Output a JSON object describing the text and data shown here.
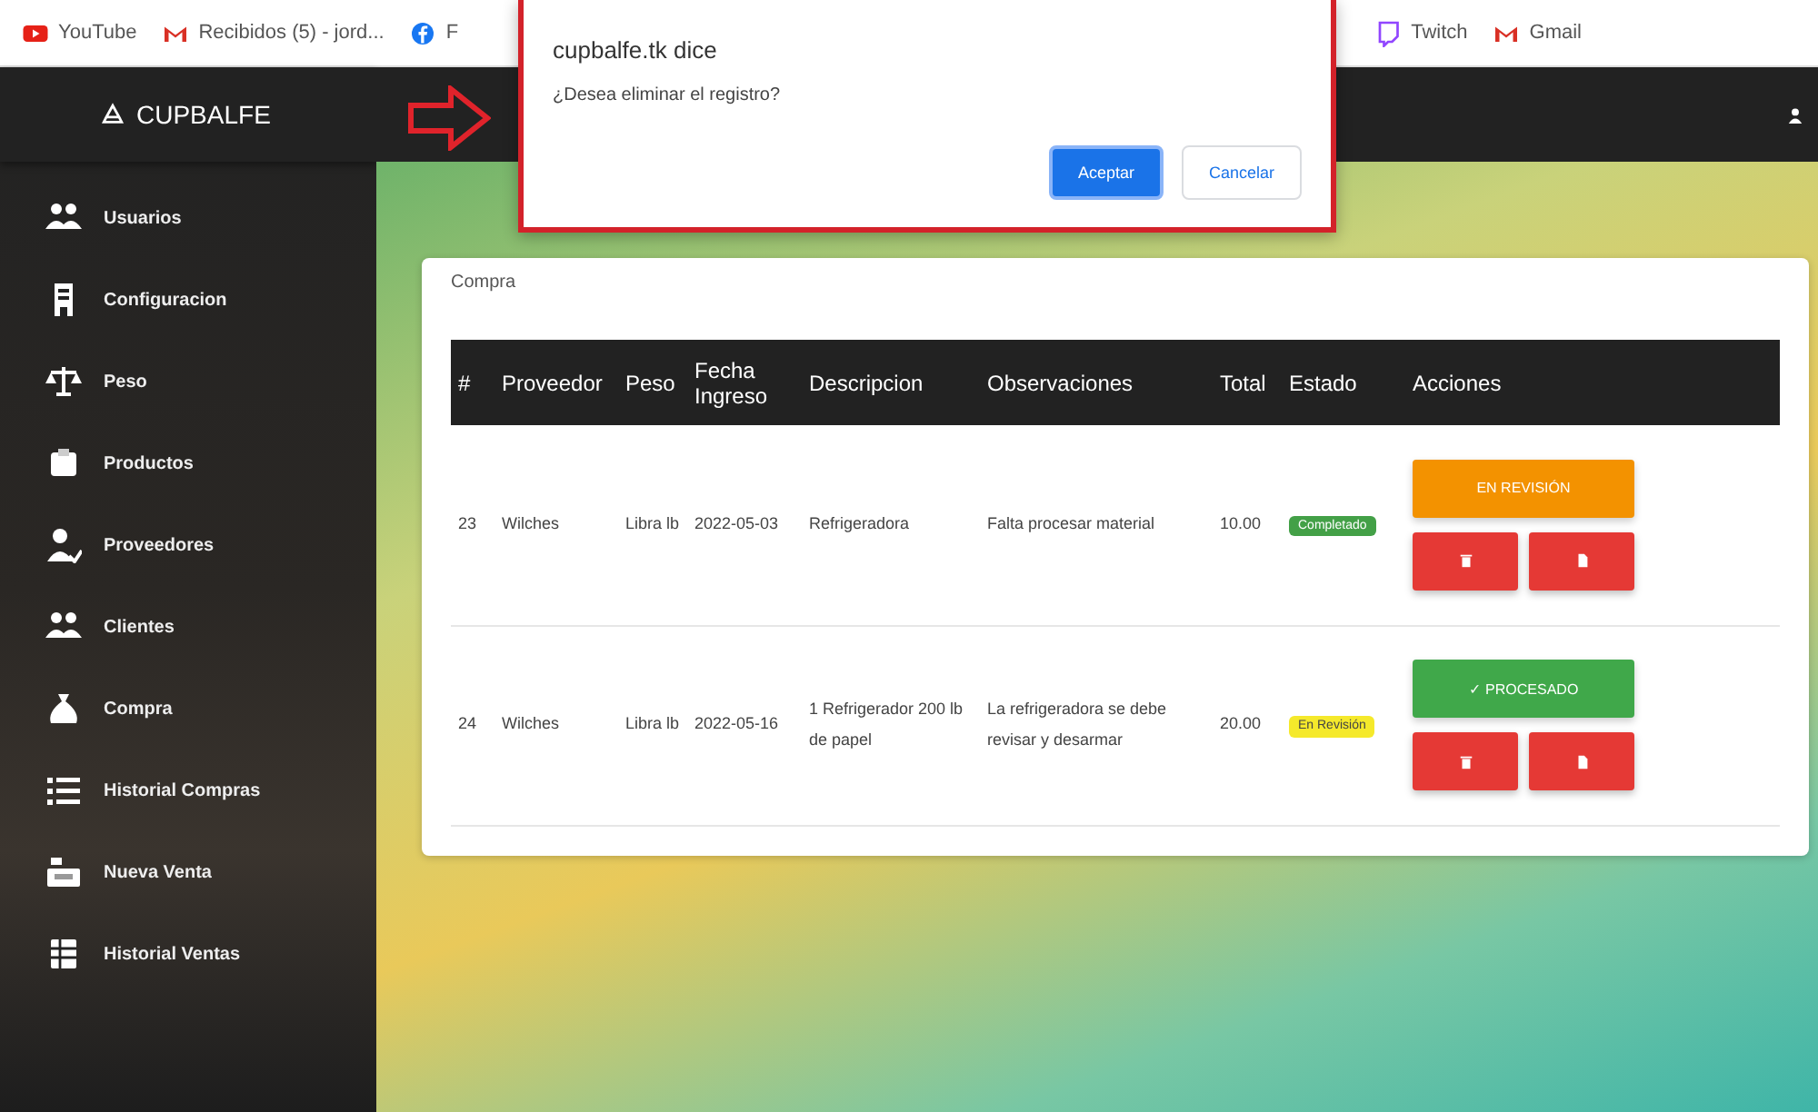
{
  "bookmarks": [
    {
      "kind": "youtube",
      "label": "YouTube"
    },
    {
      "kind": "gmail",
      "label": "Recibidos (5) - jord..."
    },
    {
      "kind": "facebook",
      "label": "F"
    },
    {
      "kind": "twitch",
      "label": "Twitch"
    },
    {
      "kind": "gmail",
      "label": "Gmail"
    }
  ],
  "brand": "CUPBALFE",
  "sidebar": {
    "items": [
      {
        "kind": "users",
        "label": "Usuarios"
      },
      {
        "kind": "building",
        "label": "Configuracion"
      },
      {
        "kind": "scale",
        "label": "Peso"
      },
      {
        "kind": "box",
        "label": "Productos"
      },
      {
        "kind": "user",
        "label": "Proveedores"
      },
      {
        "kind": "users",
        "label": "Clientes"
      },
      {
        "kind": "bag",
        "label": "Compra"
      },
      {
        "kind": "list",
        "label": "Historial Compras"
      },
      {
        "kind": "register",
        "label": "Nueva Venta"
      },
      {
        "kind": "table",
        "label": "Historial Ventas"
      }
    ]
  },
  "card": {
    "title": "Compra"
  },
  "table": {
    "columns": [
      "#",
      "Proveedor",
      "Peso",
      "Fecha Ingreso",
      "Descripcion",
      "Observaciones",
      "Total",
      "Estado",
      "Acciones"
    ],
    "rows": [
      {
        "cells": [
          "23",
          "Wilches",
          "Libra lb",
          "2022-05-03",
          "Refrigeradora",
          "Falta procesar material",
          "10.00"
        ],
        "status": {
          "kind": "completed",
          "label": "Completado"
        },
        "action": {
          "kind": "review",
          "label": "EN REVISIÓN"
        }
      },
      {
        "cells": [
          "24",
          "Wilches",
          "Libra lb",
          "2022-05-16",
          "1 Refrigerador 200 lb de papel",
          "La refrigeradora se debe revisar y desarmar",
          "20.00"
        ],
        "status": {
          "kind": "review",
          "label": "En Revisión"
        },
        "action": {
          "kind": "processed",
          "label": "✓ PROCESADO"
        }
      }
    ]
  },
  "dialog": {
    "title": "cupbalfe.tk dice",
    "message": "¿Desea eliminar el registro?",
    "buttons": [
      {
        "kind": "primary",
        "label": "Aceptar"
      },
      {
        "kind": "secondary",
        "label": "Cancelar"
      }
    ]
  }
}
